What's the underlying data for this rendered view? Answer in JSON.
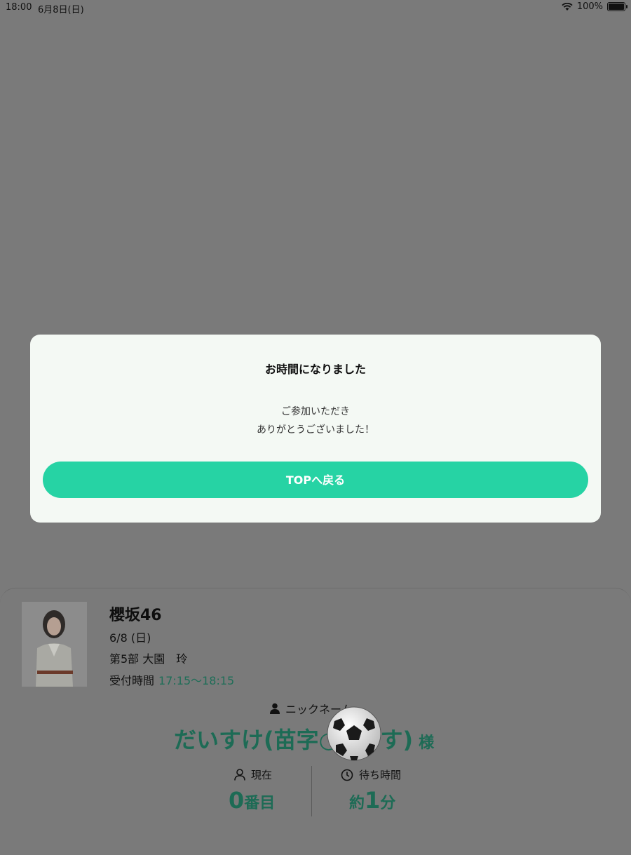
{
  "status_bar": {
    "time": "18:00",
    "date": "6月8日(日)",
    "battery": "100%",
    "battery_level": 1.0
  },
  "modal": {
    "title": "お時間になりました",
    "message_line1": "ご参加いただき",
    "message_line2": "ありがとうございました！",
    "button_label": "TOPへ戻る"
  },
  "event": {
    "group": "櫻坂46",
    "date": "6/8 (日)",
    "part": "第5部  大園　玲",
    "reception_label": "受付時間",
    "reception_time": "17:15〜18:15"
  },
  "nickname": {
    "label": "ニックネーム",
    "name": "だいすけ(苗字○○です)",
    "suffix": "様"
  },
  "stats": {
    "current_label": "現在",
    "current_value": "0",
    "current_unit": "番目",
    "wait_label": "待ち時間",
    "wait_prefix": "約",
    "wait_value": "1",
    "wait_unit": "分"
  },
  "colors": {
    "accent": "#26d3a4",
    "accent_dark": "#1d6b55",
    "overlay": "#7a7a7a",
    "modal_bg": "#f4f9f4"
  },
  "icons": {
    "wifi": "wifi-icon",
    "battery": "battery-icon",
    "person": "person-icon",
    "clock": "clock-icon",
    "ball": "soccer-ball-icon"
  }
}
